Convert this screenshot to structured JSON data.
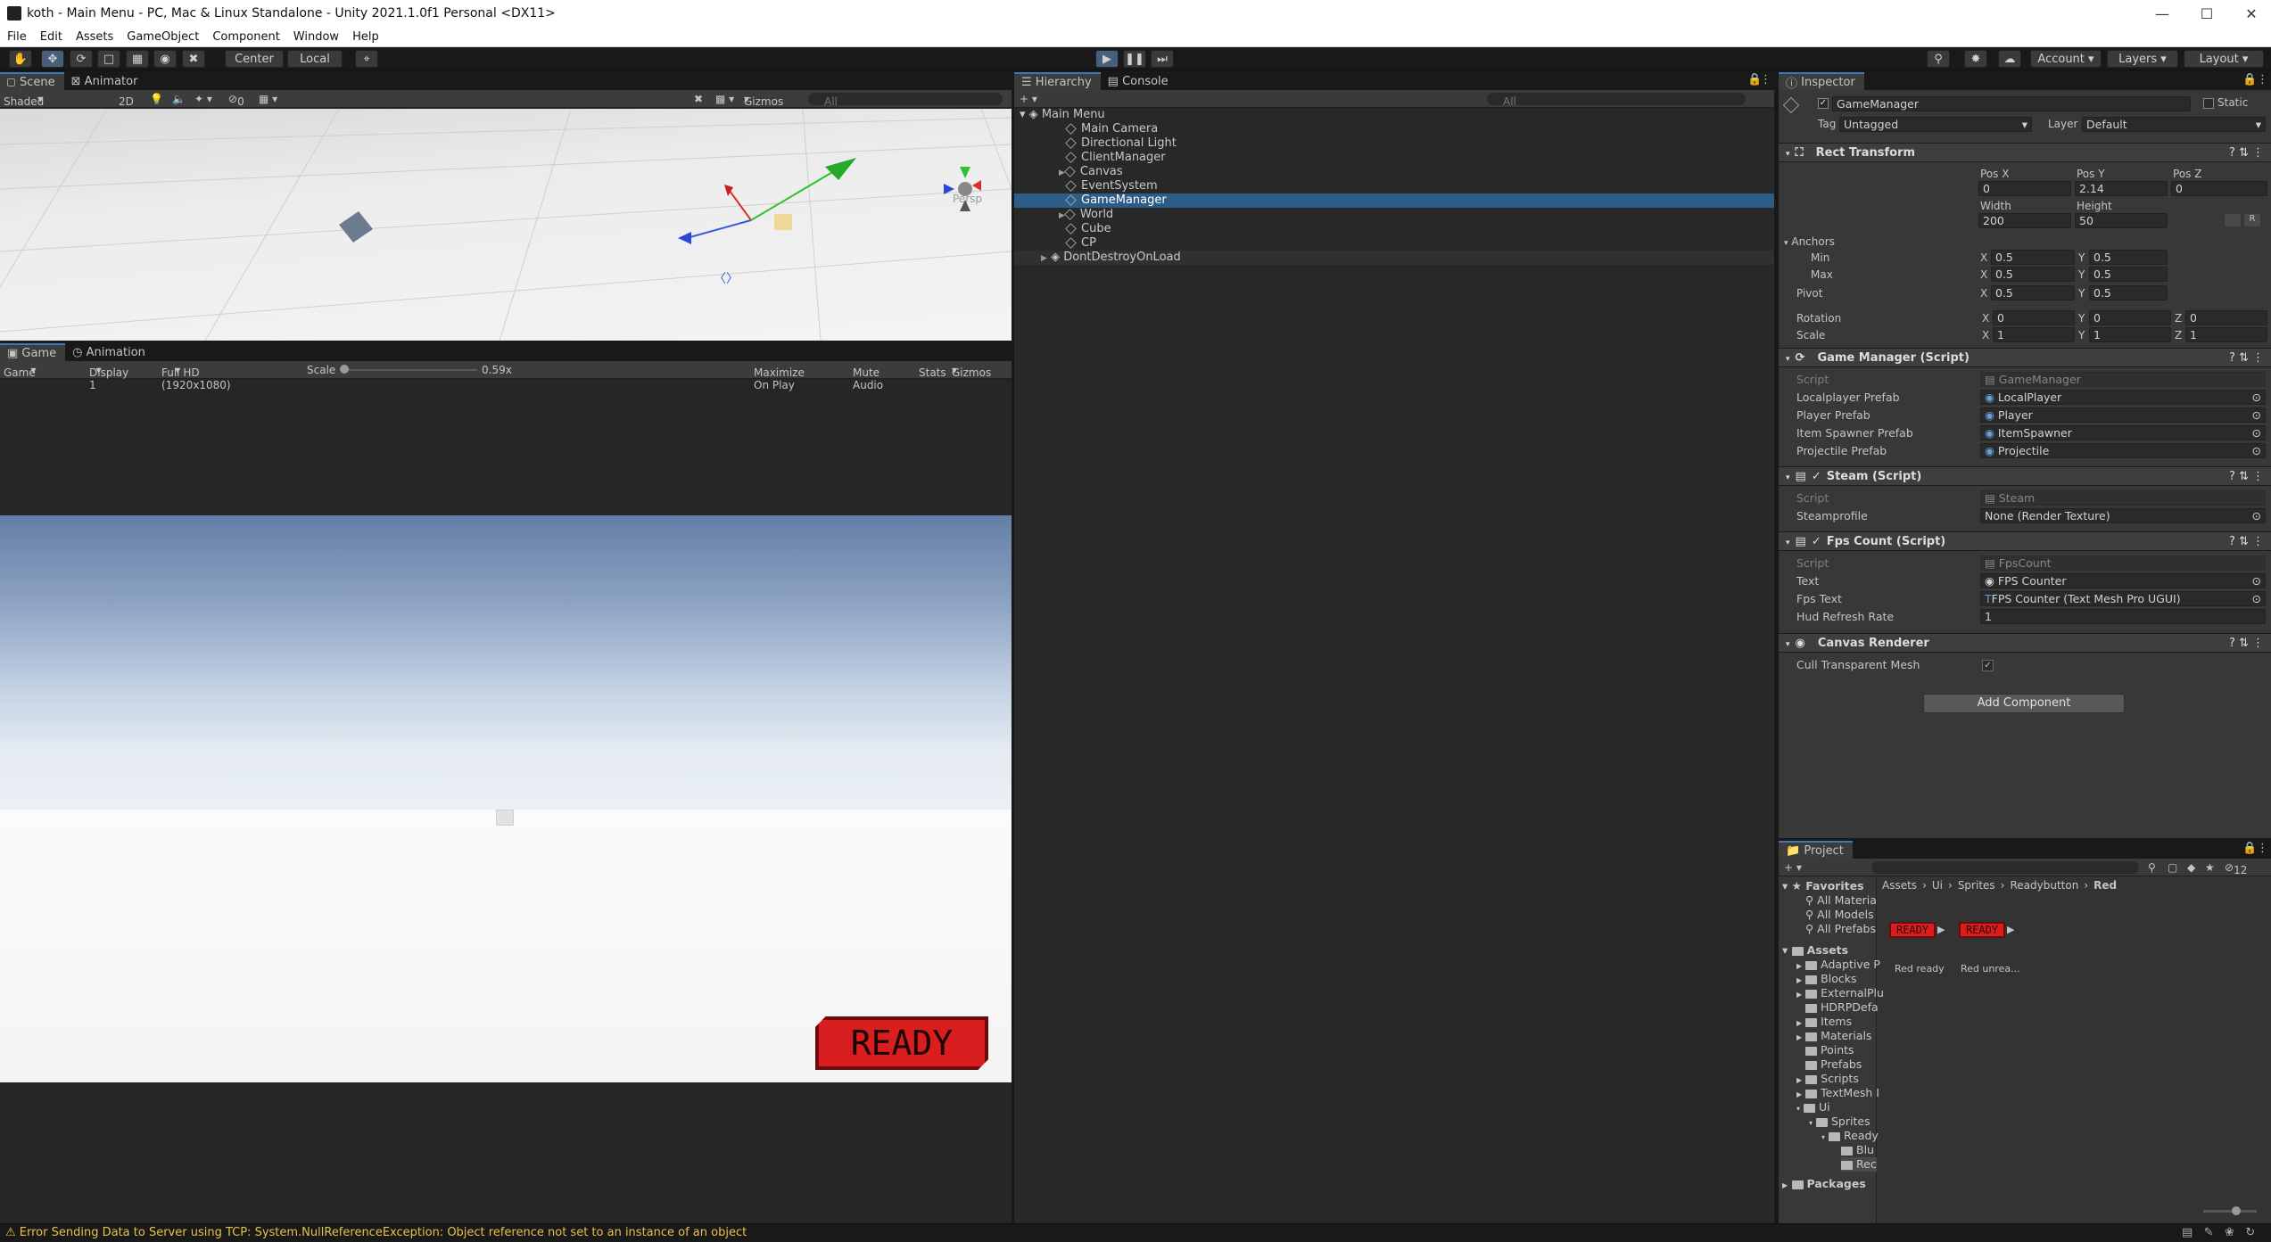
{
  "window": {
    "title": "koth - Main Menu - PC, Mac & Linux Standalone - Unity 2021.1.0f1 Personal <DX11>"
  },
  "menu": [
    "File",
    "Edit",
    "Assets",
    "GameObject",
    "Component",
    "Window",
    "Help"
  ],
  "toolbar": {
    "pivot": "Center",
    "space": "Local",
    "account": "Account",
    "layers": "Layers",
    "layout": "Layout"
  },
  "scene": {
    "tabs": [
      "Scene",
      "Animator"
    ],
    "shading": "Shaded",
    "mode2d": "2D",
    "gizmos": "Gizmos",
    "search_placeholder": "All",
    "hidden_count": "0",
    "persp": "Persp"
  },
  "game": {
    "tabs": [
      "Game",
      "Animation"
    ],
    "view": "Game",
    "display": "Display 1",
    "resolution": "Full HD (1920x1080)",
    "scale_label": "Scale",
    "scale_value": "0.59x",
    "maximize": "Maximize On Play",
    "mute": "Mute Audio",
    "stats": "Stats",
    "gizmos": "Gizmos",
    "ready_text": "READY"
  },
  "hierarchy": {
    "tabs": [
      "Hierarchy",
      "Console"
    ],
    "search_placeholder": "All",
    "scene": "Main Menu",
    "items": [
      "Main Camera",
      "Directional Light",
      "ClientManager",
      "Canvas",
      "EventSystem",
      "GameManager",
      "World",
      "Cube",
      "CP"
    ],
    "selected": "GameManager",
    "dontdestroy": "DontDestroyOnLoad"
  },
  "inspector": {
    "tab": "Inspector",
    "object_name": "GameManager",
    "static_label": "Static",
    "tag_label": "Tag",
    "tag": "Untagged",
    "layer_label": "Layer",
    "layer": "Default",
    "rect": {
      "title": "Rect Transform",
      "posx_label": "Pos X",
      "posy_label": "Pos Y",
      "posz_label": "Pos Z",
      "posx": "0",
      "posy": "2.14",
      "posz": "0",
      "width_label": "Width",
      "height_label": "Height",
      "width": "200",
      "height": "50",
      "anchors": "Anchors",
      "min": "Min",
      "max": "Max",
      "pivot": "Pivot",
      "rotation": "Rotation",
      "scale": "Scale",
      "min_x": "0.5",
      "min_y": "0.5",
      "max_x": "0.5",
      "max_y": "0.5",
      "pivot_x": "0.5",
      "pivot_y": "0.5",
      "rot_x": "0",
      "rot_y": "0",
      "rot_z": "0",
      "scale_x": "1",
      "scale_y": "1",
      "scale_z": "1"
    },
    "gm": {
      "title": "Game Manager (Script)",
      "script_label": "Script",
      "script": "GameManager",
      "rows": [
        {
          "label": "Localplayer Prefab",
          "value": "LocalPlayer"
        },
        {
          "label": "Player Prefab",
          "value": "Player"
        },
        {
          "label": "Item Spawner Prefab",
          "value": "ItemSpawner"
        },
        {
          "label": "Projectile Prefab",
          "value": "Projectile"
        }
      ]
    },
    "steam": {
      "title": "Steam (Script)",
      "script_label": "Script",
      "script": "Steam",
      "profile_label": "Steamprofile",
      "profile": "None (Render Texture)"
    },
    "fps": {
      "title": "Fps Count (Script)",
      "script_label": "Script",
      "script": "FpsCount",
      "text_label": "Text",
      "text": "FPS Counter",
      "fpstext_label": "Fps Text",
      "fpstext": "FPS Counter (Text Mesh Pro UGUI)",
      "hud_label": "Hud Refresh Rate",
      "hud": "1"
    },
    "canvas": {
      "title": "Canvas Renderer",
      "cull_label": "Cull Transparent Mesh"
    },
    "add_component": "Add Component"
  },
  "project": {
    "tab": "Project",
    "count": "12",
    "breadcrumb": [
      "Assets",
      "Ui",
      "Sprites",
      "Readybutton",
      "Red"
    ],
    "favorites": "Favorites",
    "fav_items": [
      "All Materia",
      "All Models",
      "All Prefabs"
    ],
    "assets": "Assets",
    "folders": [
      "Adaptive P",
      "Blocks",
      "ExternalPlu",
      "HDRPDefa",
      "Items",
      "Materials",
      "Points",
      "Prefabs",
      "Scripts",
      "TextMesh I",
      "Ui",
      "Sprites",
      "Ready",
      "Blu",
      "Rec"
    ],
    "packages": "Packages",
    "files": [
      {
        "name": "Red ready",
        "thumb": "READY"
      },
      {
        "name": "Red unrea...",
        "thumb": "READY"
      }
    ]
  },
  "status": {
    "message": "Error Sending Data to Server using TCP: System.NullReferenceException: Object reference not set to an instance of an object"
  },
  "colors": {
    "selection": "#2c5d87",
    "accent_tab": "#3a79bb",
    "play_active": "#46607c",
    "warning": "#e7c14a",
    "ready_red": "#d81e1e"
  }
}
